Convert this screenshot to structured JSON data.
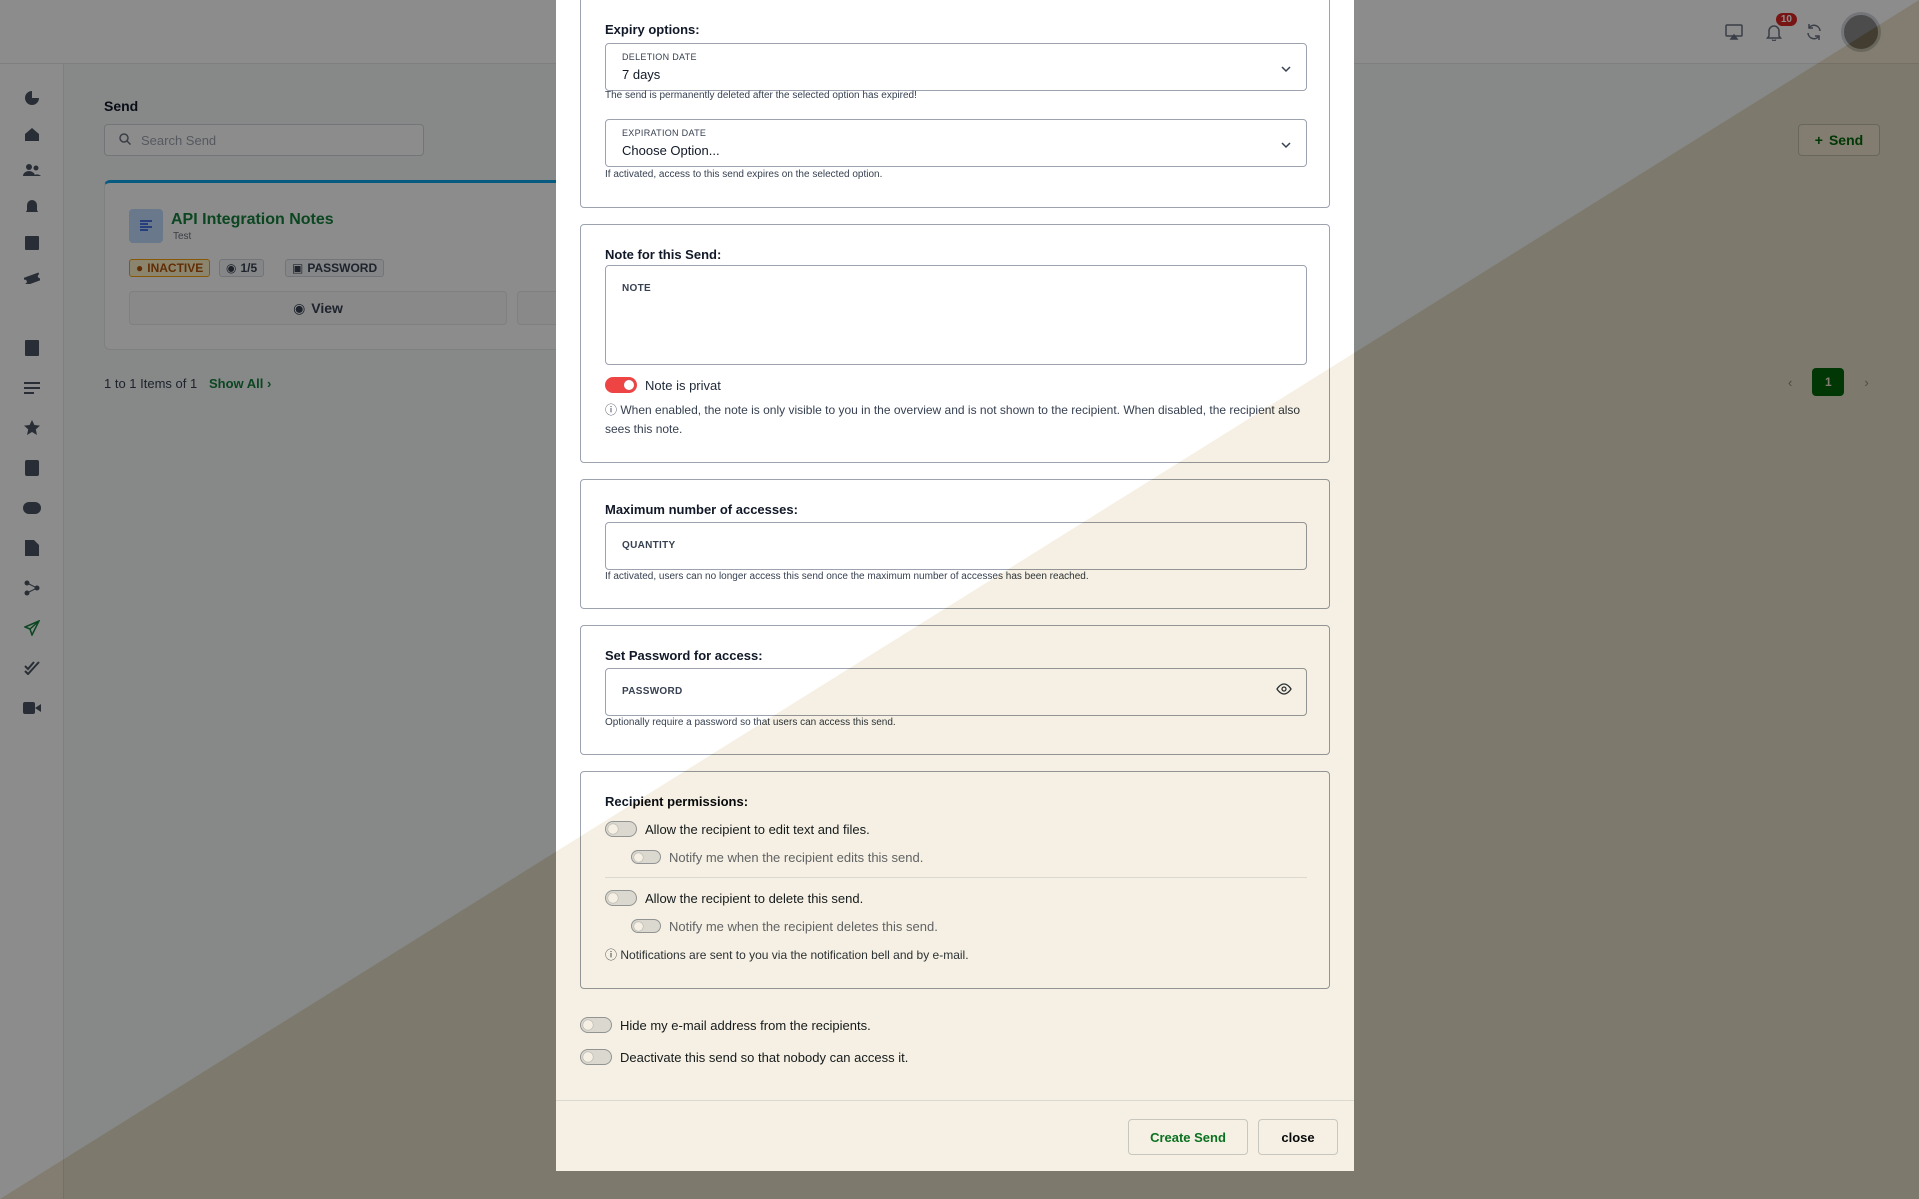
{
  "header": {
    "notification_count": "10"
  },
  "main": {
    "title": "Send",
    "search_placeholder": "Search Send",
    "send_button": "Send",
    "card": {
      "title": "API Integration Notes",
      "subtitle": "Test",
      "status": "INACTIVE",
      "views": "1/5",
      "protection": "PASSWORD",
      "view_button": "View"
    },
    "items_count": "1 to 1 Items of 1",
    "show_all": "Show All",
    "current_page": "1"
  },
  "modal": {
    "expiry": {
      "title": "Expiry options:",
      "deletion_label": "DELETION DATE",
      "deletion_value": "7 days",
      "deletion_help": "The send is permanently deleted after the selected option has expired!",
      "expiration_label": "EXPIRATION DATE",
      "expiration_value": "Choose Option...",
      "expiration_help": "If activated, access to this send expires on the selected option."
    },
    "note": {
      "title": "Note for this Send:",
      "placeholder": "NOTE",
      "private_label": "Note is privat",
      "private_info": "When enabled, the note is only visible to you in the overview and is not shown to the recipient. When disabled, the recipient also sees this note."
    },
    "max_access": {
      "title": "Maximum number of accesses:",
      "placeholder": "QUANTITY",
      "help": "If activated, users can no longer access this send once the maximum number of accesses has been reached."
    },
    "password": {
      "title": "Set Password for access:",
      "placeholder": "PASSWORD",
      "help": "Optionally require a password so that users can access this send."
    },
    "permissions": {
      "title": "Recipient permissions:",
      "edit_label": "Allow the recipient to edit text and files.",
      "notify_edit_label": "Notify me when the recipient edits this send.",
      "delete_label": "Allow the recipient to delete this send.",
      "notify_delete_label": "Notify me when the recipient deletes this send.",
      "info": "Notifications are sent to you via the notification bell and by e-mail."
    },
    "hide_email_label": "Hide my e-mail address from the recipients.",
    "deactivate_label": "Deactivate this send so that nobody can access it.",
    "create_button": "Create Send",
    "close_button": "close"
  },
  "colors": {
    "accent": "#15803d",
    "toggle_on": "#ef4444",
    "badge": "#dc2626"
  }
}
